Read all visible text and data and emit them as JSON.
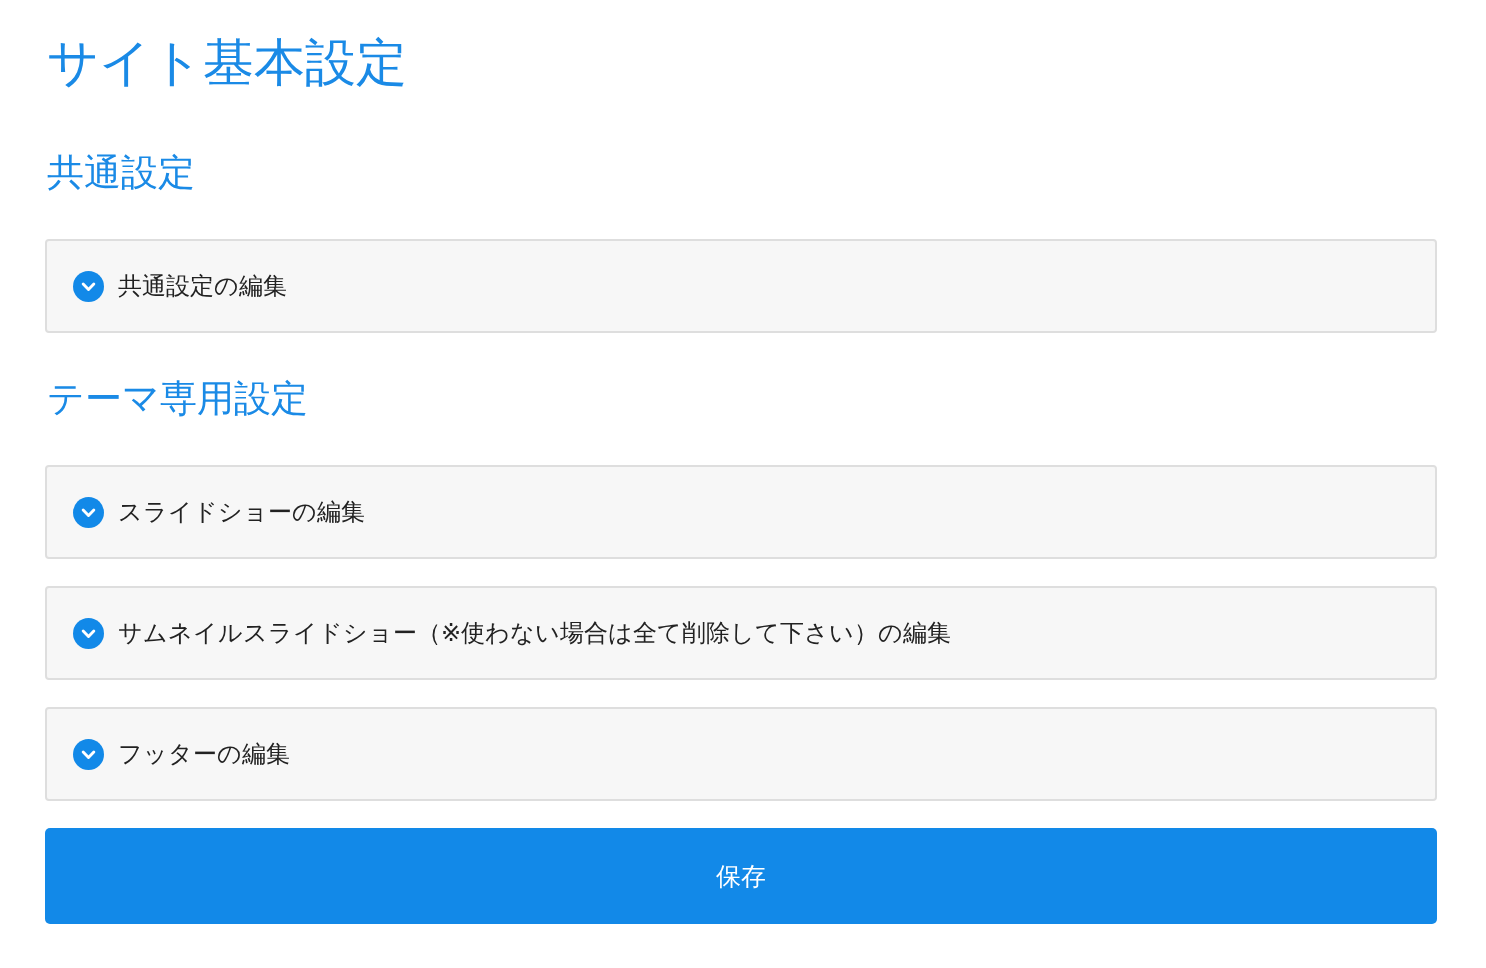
{
  "page_title": "サイト基本設定",
  "sections": [
    {
      "heading": "共通設定",
      "panels": [
        {
          "label": "共通設定の編集",
          "expanded": false
        }
      ]
    },
    {
      "heading": "テーマ専用設定",
      "panels": [
        {
          "label": "スライドショーの編集",
          "expanded": false
        },
        {
          "label": "サムネイルスライドショー（※使わない場合は全て削除して下さい）の編集",
          "expanded": false
        },
        {
          "label": "フッターの編集",
          "expanded": false
        }
      ]
    }
  ],
  "save_button": {
    "label": "保存"
  }
}
